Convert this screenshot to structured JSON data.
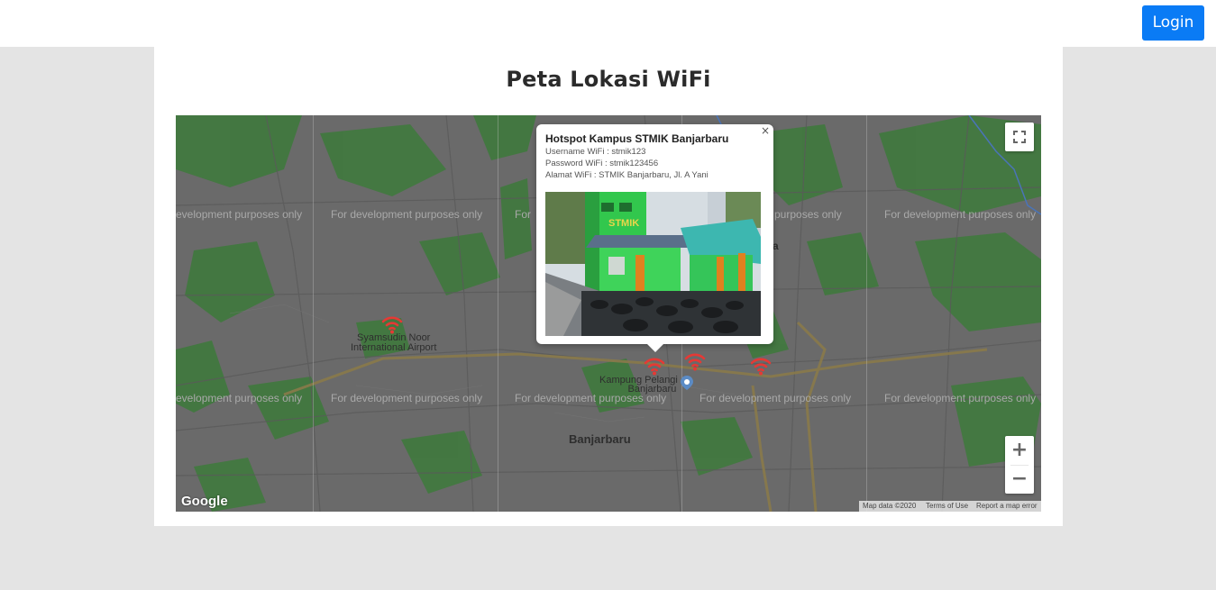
{
  "header": {
    "login_label": "Login"
  },
  "page": {
    "title": "Peta Lokasi WiFi"
  },
  "map": {
    "watermark": "For development purposes only",
    "watermark_partial": "evelopment purposes only",
    "watermark_partial_mid": "For",
    "places": {
      "airport_line1": "Syamsudin Noor",
      "airport_line2": "International Airport",
      "kampung_line1": "Kampung Pelangi",
      "kampung_line2": "Banjarbaru",
      "city": "Banjarbaru",
      "partial": "a"
    },
    "google_logo": "Google",
    "attribution": {
      "map_data": "Map data ©2020",
      "terms": "Terms of Use",
      "report": "Report a map error"
    },
    "zoom_in": "+",
    "zoom_out": "−",
    "marker_icon": "wifi-icon",
    "marker_color": "#e53935"
  },
  "popup": {
    "close": "×",
    "title": "Hotspot Kampus STMIK Banjarbaru",
    "username": "Username WiFi : stmik123",
    "password": "Password WiFi : stmik123456",
    "address": "Alamat WiFi : STMIK Banjarbaru, Jl. A Yani",
    "photo_sign": "STMIK"
  },
  "colors": {
    "accent": "#0a7bf5",
    "map_background": "#6a6a6a",
    "greenery": "#3d7a3b",
    "roads": "#8a7a4a"
  }
}
